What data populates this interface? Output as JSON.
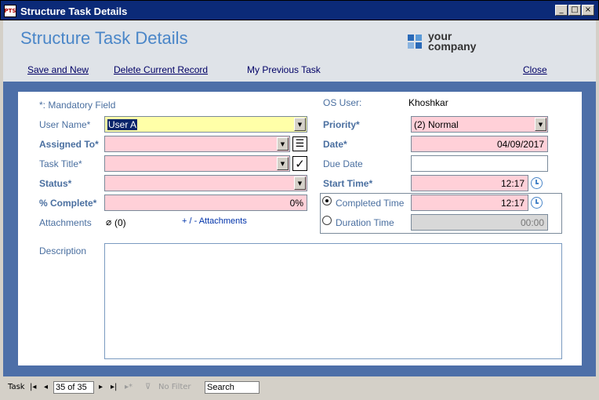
{
  "window": {
    "title": "Structure Task Details",
    "app_icon_text": "PTS",
    "minimize": "_",
    "maximize": "□",
    "close": "×"
  },
  "header": {
    "form_title": "Structure Task Details",
    "logo": {
      "line1": "your",
      "line2": "company"
    },
    "links": {
      "save_and_new": "Save and New",
      "delete_current_record": "Delete Current Record",
      "my_previous_task": "My Previous Task",
      "close": "Close"
    }
  },
  "form": {
    "mandatory_note": "*: Mandatory Field",
    "os_user": {
      "label": "OS User:",
      "value": "Khoshkar"
    },
    "user_name": {
      "label": "User Name*",
      "value": "User A"
    },
    "assigned_to": {
      "label": "Assigned To*",
      "value": ""
    },
    "task_title": {
      "label": "Task Title*",
      "value": ""
    },
    "status": {
      "label": "Status*",
      "value": ""
    },
    "percent_complete": {
      "label": "% Complete*",
      "value": "0%"
    },
    "attachments": {
      "label": "Attachments",
      "count": "(0)",
      "link": "+ / -  Attachments"
    },
    "description": {
      "label": "Description",
      "value": ""
    },
    "priority": {
      "label": "Priority*",
      "value": "(2) Normal"
    },
    "date": {
      "label": "Date*",
      "value": "04/09/2017"
    },
    "due_date": {
      "label": "Due Date",
      "value": ""
    },
    "start_time": {
      "label": "Start Time*",
      "value": "12:17"
    },
    "completed_time": {
      "label": "Completed Time",
      "value": "12:17",
      "selected": true
    },
    "duration_time": {
      "label": "Duration Time",
      "value": "00:00",
      "selected": false
    }
  },
  "navbar": {
    "record_label": "Task",
    "first": "|◂",
    "prev": "◂",
    "record_position": "35 of 35",
    "next": "▸",
    "last": "▸|",
    "new": "▸*",
    "filter_label": "No Filter",
    "search_placeholder": "Search"
  },
  "colors": {
    "mandatory_fill": "#ffd0d8",
    "focused_fill": "#ffffa8",
    "label_blue": "#4a6fa0",
    "frame_blue": "#4d6fa8"
  }
}
